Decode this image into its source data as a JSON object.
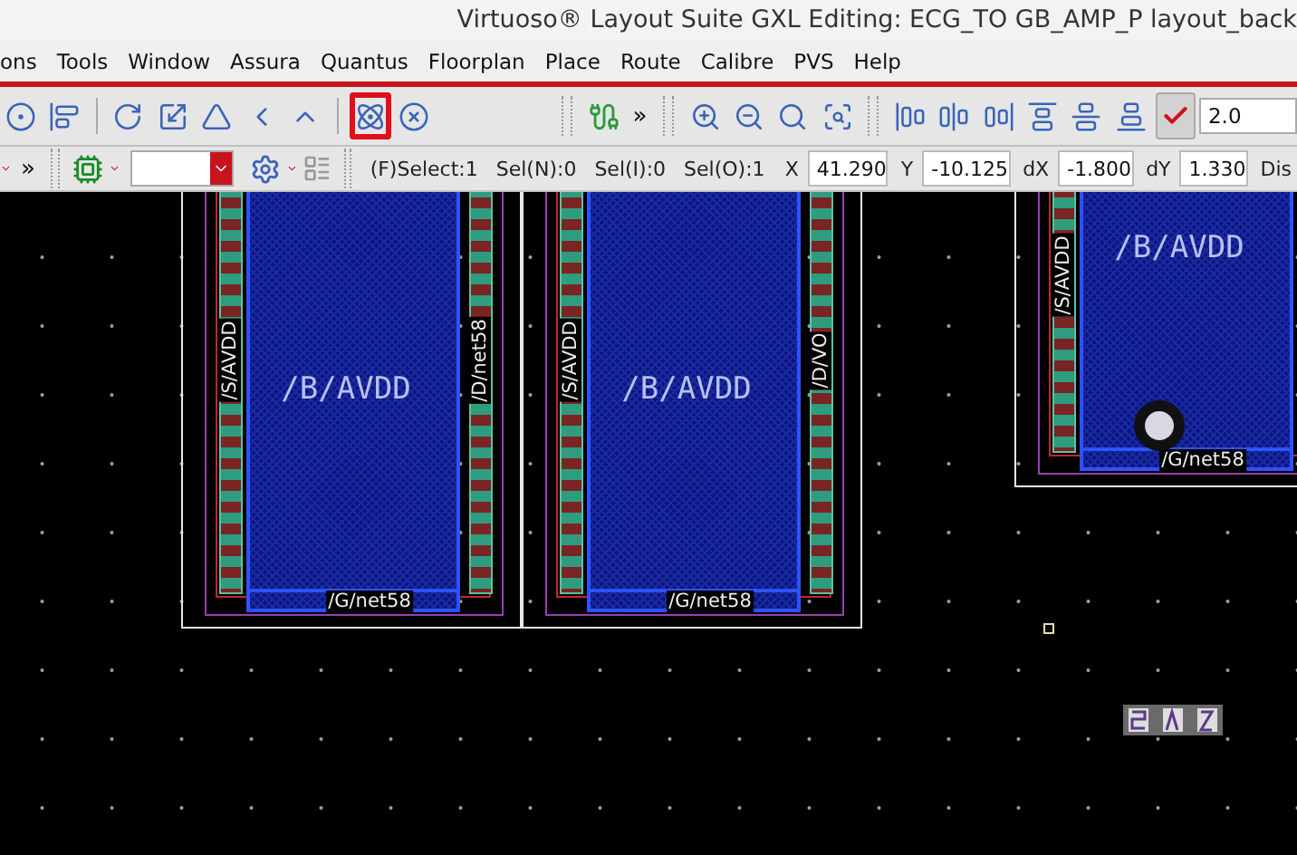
{
  "window": {
    "title": "Virtuoso® Layout Suite GXL Editing: ECG_TO GB_AMP_P layout_back"
  },
  "menu": [
    "ons",
    "Tools",
    "Window",
    "Assura",
    "Quantus",
    "Floorplan",
    "Place",
    "Route",
    "Calibre",
    "PVS",
    "Help"
  ],
  "toolbar": {
    "groups": [
      {
        "tools": [
          {
            "kind": "ring",
            "highlighted": false
          },
          {
            "kind": "align",
            "highlighted": false
          }
        ]
      },
      {
        "tools": [
          {
            "kind": "rotate",
            "highlighted": false
          },
          {
            "kind": "stretch",
            "highlighted": false
          },
          {
            "kind": "mirror",
            "highlighted": false
          },
          {
            "kind": "flip-left",
            "highlighted": false
          },
          {
            "kind": "flip-up",
            "highlighted": false
          }
        ]
      },
      {
        "tools": [
          {
            "kind": "cluster",
            "highlighted": true
          },
          {
            "kind": "cluster-delete",
            "highlighted": false
          }
        ]
      }
    ],
    "overflow": "»",
    "zoom_tools": [
      {
        "kind": "zoom-in"
      },
      {
        "kind": "zoom-out"
      },
      {
        "kind": "zoom-fit"
      },
      {
        "kind": "zoom-area"
      }
    ],
    "align_tools": [
      {
        "kind": "align-left"
      },
      {
        "kind": "align-center"
      },
      {
        "kind": "align-right"
      },
      {
        "kind": "align-top"
      },
      {
        "kind": "align-middle"
      },
      {
        "kind": "align-bottom"
      }
    ],
    "snap_checked": true,
    "grid_value": "2.0"
  },
  "statusbar": {
    "overflow": "»",
    "status": [
      "(F)Select:1",
      "Sel(N):0",
      "Sel(I):0",
      "Sel(O):1"
    ],
    "coords": [
      {
        "label": "X",
        "value": "41.290"
      },
      {
        "label": "Y",
        "value": "-10.125"
      },
      {
        "label": "dX",
        "value": "-1.800"
      },
      {
        "label": "dY",
        "value": "1.330"
      }
    ],
    "trailing": "Dis"
  },
  "canvas": {
    "cells": [
      {
        "center_label": "/B/AVDD",
        "source_label": "/S/AVDD",
        "drain_label": "/D/net58",
        "gate_label": "/G/net58"
      },
      {
        "center_label": "/B/AVDD",
        "source_label": "/S/AVDD",
        "drain_label": "/D/VO",
        "gate_label": "/G/net58"
      },
      {
        "center_label": "/B/AVDD",
        "source_label": "/S/AVDD",
        "gate_label": "/G/net58"
      }
    ]
  }
}
